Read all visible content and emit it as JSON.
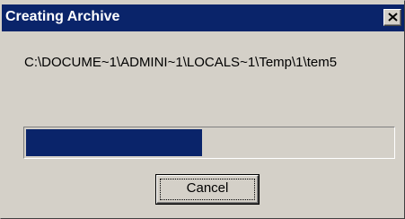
{
  "window": {
    "title": "Creating Archive",
    "close_icon": "close-x-icon",
    "titlebar_color": "#0a246a"
  },
  "status": {
    "path": "C:\\DOCUME~1\\ADMINI~1\\LOCALS~1\\Temp\\1\\tem5"
  },
  "progress": {
    "fraction": 0.48,
    "fill_color": "#0a246a"
  },
  "buttons": {
    "cancel_label": "Cancel"
  }
}
